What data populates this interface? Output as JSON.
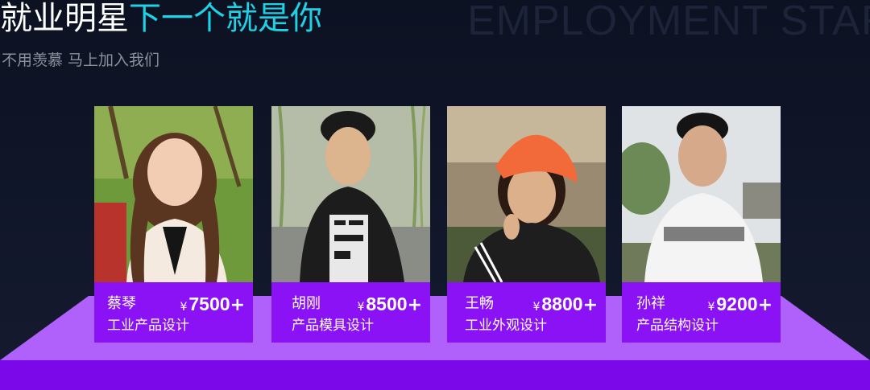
{
  "header": {
    "bg_word": "EMPLOYMENT STAR",
    "title_main": "就业明星",
    "title_highlight": "下一个就是你",
    "subtitle": "不用羡慕 马上加入我们"
  },
  "colors": {
    "accent": "#1ed2e6",
    "card": "#8a12f4",
    "stage_top": "#b060fb",
    "stage_front": "#7a08e8"
  },
  "stars": [
    {
      "name": "蔡琴",
      "yen": "¥",
      "salary": "7500",
      "plus": "+",
      "role": "工业产品设计",
      "photo": "young-woman-portrait"
    },
    {
      "name": "胡刚",
      "yen": "¥",
      "salary": "8500",
      "plus": "+",
      "role": "产品模具设计",
      "photo": "young-man-portrait"
    },
    {
      "name": "王畅",
      "yen": "¥",
      "salary": "8800",
      "plus": "+",
      "role": "工业外观设计",
      "photo": "woman-orange-cap-portrait"
    },
    {
      "name": "孙祥",
      "yen": "¥",
      "salary": "9200",
      "plus": "+",
      "role": "产品结构设计",
      "photo": "man-white-tshirt-portrait"
    }
  ]
}
